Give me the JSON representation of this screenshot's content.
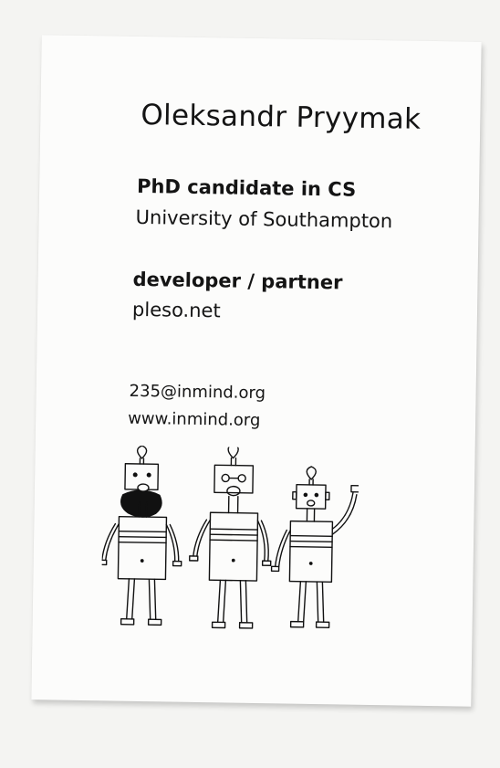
{
  "card": {
    "name": "Oleksandr Pryymak",
    "role1_title": "PhD candidate in CS",
    "role1_org": "University of Southampton",
    "role2_title": "developer / partner",
    "role2_org": "pleso.net",
    "email": "235@inmind.org",
    "website": "www.inmind.org"
  }
}
